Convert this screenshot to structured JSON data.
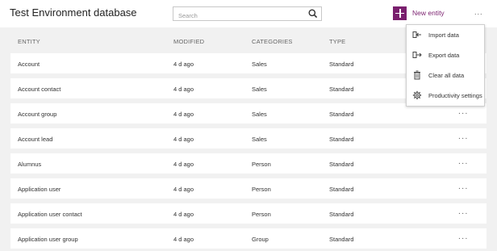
{
  "header": {
    "title": "Test Environment database",
    "search_placeholder": "Search",
    "new_entity_label": "New entity",
    "more_label": "..."
  },
  "columns": [
    "ENTITY",
    "MODIFIED",
    "CATEGORIES",
    "TYPE"
  ],
  "rows": [
    {
      "entity": "Account",
      "modified": "4 d ago",
      "category": "Sales",
      "type": "Standard",
      "more": "..."
    },
    {
      "entity": "Account contact",
      "modified": "4 d ago",
      "category": "Sales",
      "type": "Standard",
      "more": "..."
    },
    {
      "entity": "Account group",
      "modified": "4 d ago",
      "category": "Sales",
      "type": "Standard",
      "more": "..."
    },
    {
      "entity": "Account lead",
      "modified": "4 d ago",
      "category": "Sales",
      "type": "Standard",
      "more": "..."
    },
    {
      "entity": "Alumnus",
      "modified": "4 d ago",
      "category": "Person",
      "type": "Standard",
      "more": "..."
    },
    {
      "entity": "Application user",
      "modified": "4 d ago",
      "category": "Person",
      "type": "Standard",
      "more": "..."
    },
    {
      "entity": "Application user contact",
      "modified": "4 d ago",
      "category": "Person",
      "type": "Standard",
      "more": "..."
    },
    {
      "entity": "Application user group",
      "modified": "4 d ago",
      "category": "Group",
      "type": "Standard",
      "more": "..."
    }
  ],
  "menu": {
    "items": [
      {
        "label": "Import data",
        "icon": "import-icon"
      },
      {
        "label": "Export data",
        "icon": "export-icon"
      },
      {
        "label": "Clear all data",
        "icon": "trash-icon"
      },
      {
        "label": "Productivity settings",
        "icon": "gear-icon"
      }
    ]
  },
  "colors": {
    "accent": "#7a1f6e",
    "content_bg": "#f1f1f1"
  }
}
